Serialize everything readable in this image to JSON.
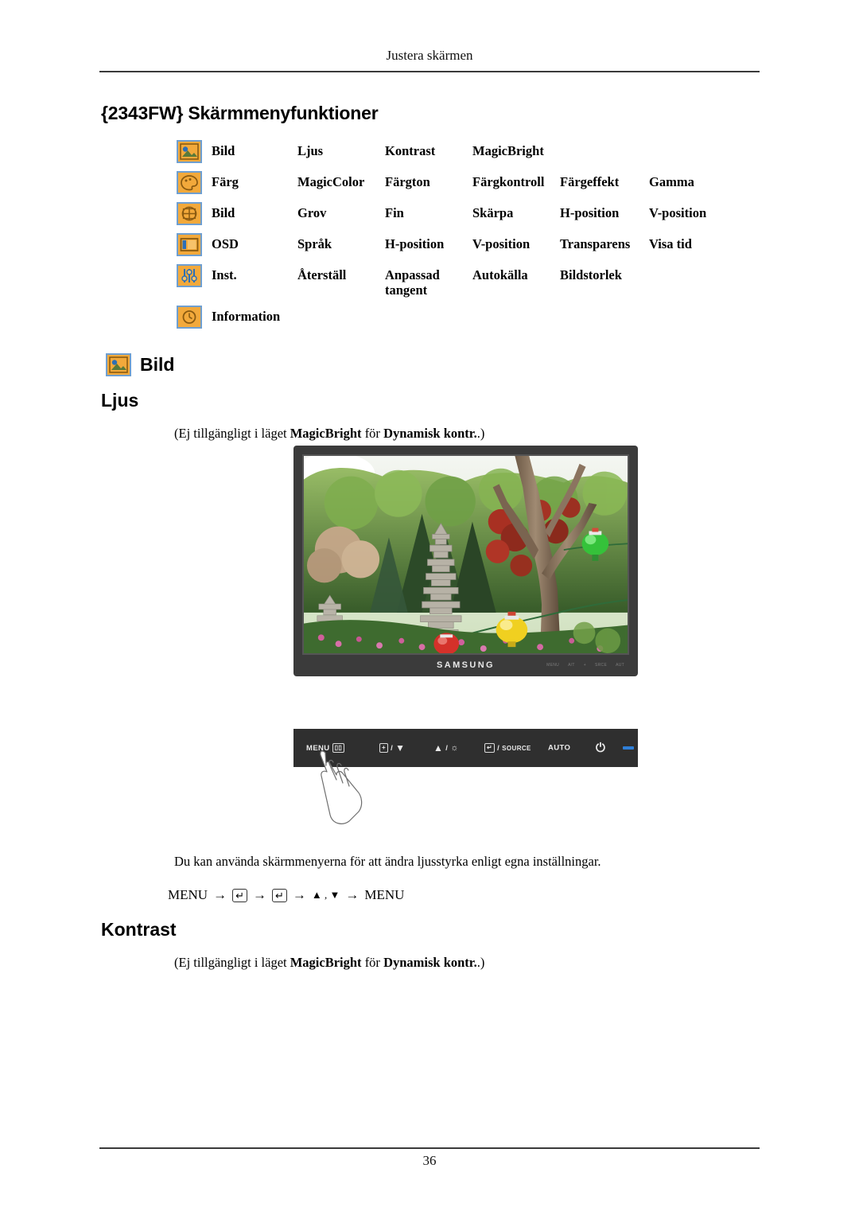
{
  "header": {
    "running_head": "Justera skärmen",
    "chapter_title": "{2343FW} Skärmmenyfunktioner"
  },
  "menu_matrix": {
    "rows": [
      {
        "icon": "picture-icon",
        "category": "Bild",
        "items": [
          "Ljus",
          "Kontrast",
          "MagicBright",
          "",
          "",
          ""
        ]
      },
      {
        "icon": "color-palette-icon",
        "category": "Färg",
        "items": [
          "MagicColor",
          "Färgton",
          "Färgkontroll",
          "Färgeffekt",
          "Gamma",
          ""
        ]
      },
      {
        "icon": "screen-geometry-icon",
        "category": "Bild",
        "items": [
          "Grov",
          "Fin",
          "Skärpa",
          "H-position",
          "V-position",
          ""
        ]
      },
      {
        "icon": "osd-icon",
        "category": "OSD",
        "items": [
          "Språk",
          "H-position",
          "V-position",
          "Transparens",
          "Visa tid",
          ""
        ]
      },
      {
        "icon": "settings-sliders-icon",
        "category": "Inst.",
        "items": [
          "Återställ",
          "Anpassad\ntangent",
          "Autokälla",
          "Bildstorlek",
          "",
          ""
        ]
      },
      {
        "icon": "information-clock-icon",
        "category": "Information",
        "items": [
          "",
          "",
          "",
          "",
          "",
          ""
        ]
      }
    ]
  },
  "section": {
    "icon_heading": {
      "icon": "picture-icon",
      "label": "Bild"
    },
    "ljus": {
      "heading": "Ljus",
      "note_prefix": "(Ej tillgängligt i läget ",
      "note_bold1": "MagicBright",
      "note_mid": " för ",
      "note_bold2": "Dynamisk kontr.",
      "note_suffix": ".)"
    },
    "kontrast": {
      "heading": "Kontrast",
      "note_prefix": "(Ej tillgängligt i läget ",
      "note_bold1": "MagicBright",
      "note_mid": " för ",
      "note_bold2": "Dynamisk kontr.",
      "note_suffix": ".)"
    }
  },
  "monitor": {
    "brand": "SAMSUNG",
    "bezel_marks": [
      "MENU",
      "A/T",
      "+",
      "SRCE",
      "AUT",
      "",
      ""
    ]
  },
  "control_panel": {
    "menu_label": "MENU",
    "menu_key": "▯▯",
    "down_key": "+",
    "down_sep": "/",
    "down_arrow": "▼",
    "up_arrow": "▲",
    "up_sep": "/",
    "up_glyph": "☼",
    "source_key": "↵",
    "source_sep": "/",
    "source_label": "SOURCE",
    "auto_label": "AUTO",
    "power_glyph": "⏻",
    "led": "power-led"
  },
  "body": {
    "description": "Du kan använda skärmmenyerna för att ändra ljusstyrka enligt egna inställningar.",
    "nav": {
      "start": "MENU",
      "arrow1": "→",
      "key1": "↵",
      "arrow2": "→",
      "key2": "↵",
      "arrow3": "→",
      "updown": "▲ , ▼",
      "arrow4": "→",
      "end": "MENU"
    }
  },
  "footer": {
    "page_number": "36"
  },
  "colors": {
    "icon_fill": "#f2a93b",
    "icon_border": "#6f9fd0",
    "bezel": "#3b3b3b",
    "panel": "#2f2f2f",
    "led_blue": "#2f7fd8",
    "rule": "#3a3a3a"
  }
}
